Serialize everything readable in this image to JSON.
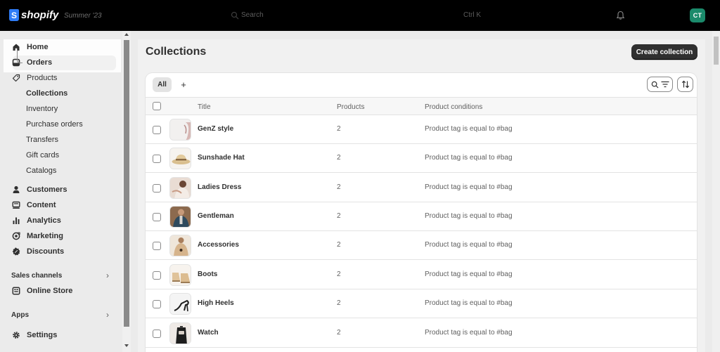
{
  "topbar": {
    "logo_mark": "S",
    "logo_text": "shopify",
    "edition": "Summer '23",
    "search_placeholder": "Search",
    "search_shortcut": "Ctrl K",
    "avatar_initials": "CT"
  },
  "sidebar": {
    "items": [
      {
        "label": "Home",
        "icon": "home-icon"
      },
      {
        "label": "Orders",
        "icon": "inbox-icon"
      },
      {
        "label": "Products",
        "icon": "tag-icon"
      },
      {
        "label": "Customers",
        "icon": "person-icon"
      },
      {
        "label": "Content",
        "icon": "content-icon"
      },
      {
        "label": "Analytics",
        "icon": "bar-chart-icon"
      },
      {
        "label": "Marketing",
        "icon": "target-icon"
      },
      {
        "label": "Discounts",
        "icon": "discount-icon"
      }
    ],
    "product_subitems": [
      "Collections",
      "Inventory",
      "Purchase orders",
      "Transfers",
      "Gift cards",
      "Catalogs"
    ],
    "sales_channels_label": "Sales channels",
    "online_store_label": "Online Store",
    "apps_label": "Apps",
    "settings_label": "Settings"
  },
  "page": {
    "title": "Collections",
    "create_button": "Create collection"
  },
  "tabs": {
    "all": "All",
    "add": "+"
  },
  "table": {
    "headers": {
      "title": "Title",
      "products": "Products",
      "conditions": "Product conditions"
    },
    "rows": [
      {
        "title": "GenZ style",
        "products": "2",
        "conditions": "Product tag is equal to #bag"
      },
      {
        "title": "Sunshade Hat",
        "products": "2",
        "conditions": "Product tag is equal to #bag"
      },
      {
        "title": "Ladies Dress",
        "products": "2",
        "conditions": "Product tag is equal to #bag"
      },
      {
        "title": "Gentleman",
        "products": "2",
        "conditions": "Product tag is equal to #bag"
      },
      {
        "title": "Accessories",
        "products": "2",
        "conditions": "Product tag is equal to #bag"
      },
      {
        "title": "Boots",
        "products": "2",
        "conditions": "Product tag is equal to #bag"
      },
      {
        "title": "High Heels",
        "products": "2",
        "conditions": "Product tag is equal to #bag"
      },
      {
        "title": "Watch",
        "products": "2",
        "conditions": "Product tag is equal to #bag"
      }
    ]
  },
  "colors": {
    "topbar": "#000000",
    "sidebar": "#ebebeb",
    "primary_button": "#303030",
    "avatar": "#1b8a6b",
    "logo": "#2f7cf6"
  }
}
